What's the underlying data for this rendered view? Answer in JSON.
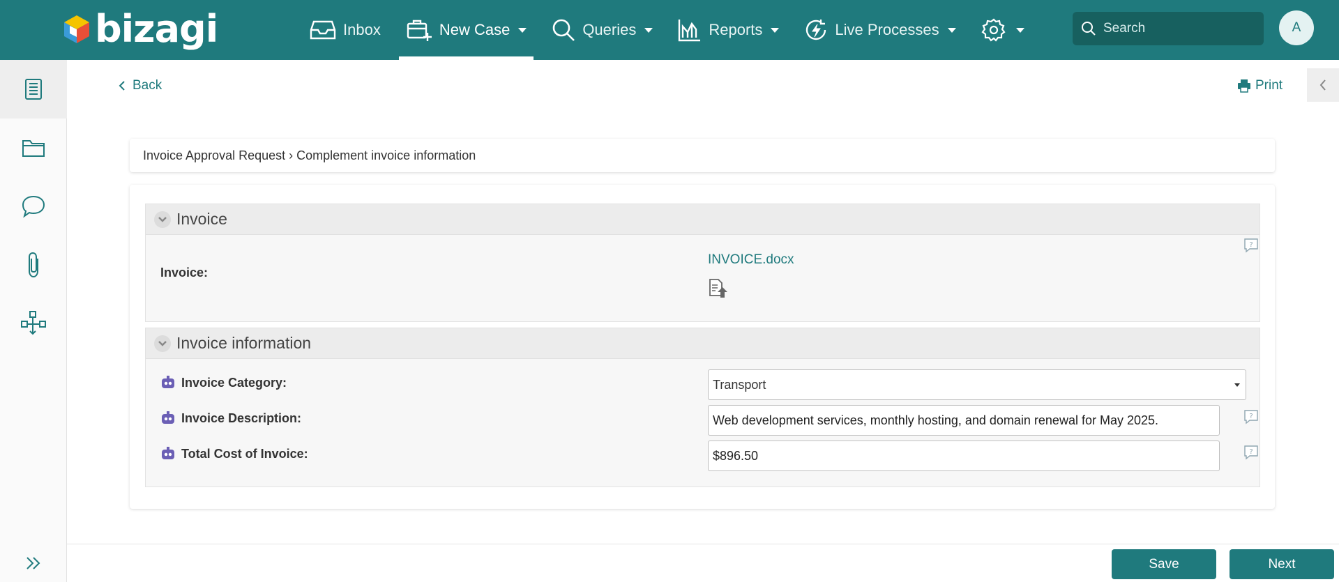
{
  "brand": {
    "name": "bizagi"
  },
  "nav": {
    "inbox": "Inbox",
    "new_case": "New Case",
    "queries": "Queries",
    "reports": "Reports",
    "live_processes": "Live Processes"
  },
  "search": {
    "placeholder": "Search"
  },
  "user": {
    "initial": "A"
  },
  "actions": {
    "back": "Back",
    "print": "Print"
  },
  "breadcrumb": "Invoice Approval Request › Complement invoice information",
  "groups": {
    "invoice": {
      "title": "Invoice",
      "label": "Invoice:",
      "file_name": "INVOICE.docx"
    },
    "invoice_info": {
      "title": "Invoice information",
      "category_label": "Invoice Category:",
      "category_value": "Transport",
      "description_label": "Invoice Description:",
      "description_value": "Web development services, monthly hosting, and domain renewal for May 2025.",
      "total_label": "Total Cost of Invoice:",
      "total_value": "$896.50"
    }
  },
  "footer": {
    "save": "Save",
    "next": "Next"
  },
  "colors": {
    "primary": "#1f7a7d",
    "search_bg": "#17605f",
    "bot_icon": "#6b5fb5"
  }
}
